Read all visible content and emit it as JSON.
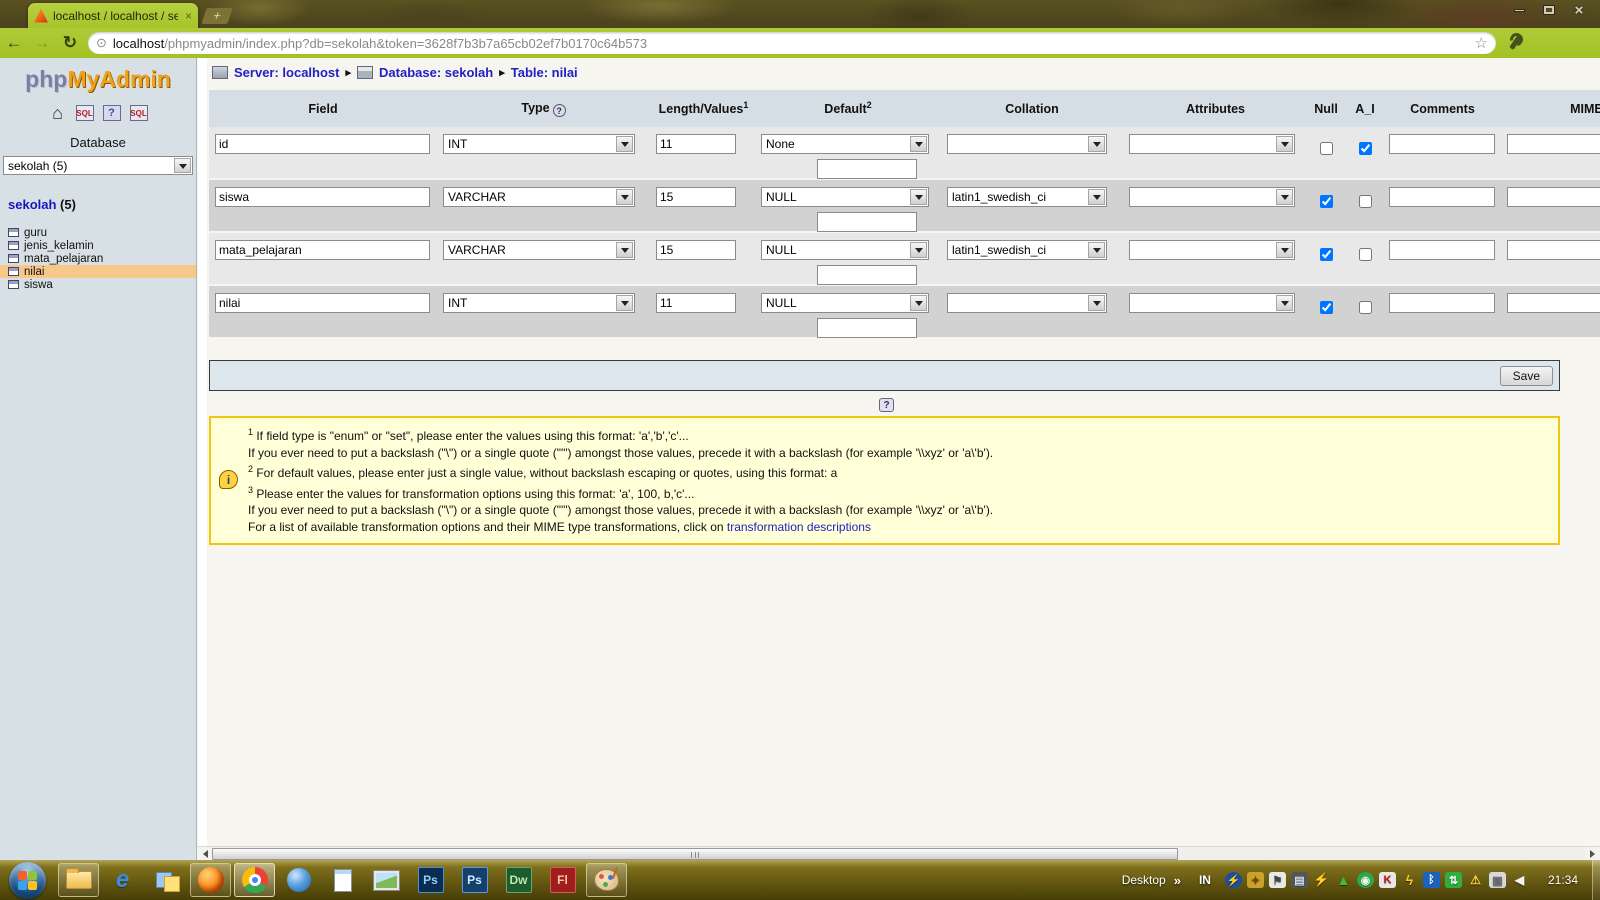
{
  "browser": {
    "tab_title": "localhost / localhost / sekol",
    "url_host": "localhost",
    "url_path": "/phpmyadmin/index.php?db=sekolah&token=3628f7b3b7a65cb02ef7b0170c64b573"
  },
  "icons": {
    "back_arrow": "←",
    "forward_arrow": "→",
    "reload": "↻",
    "globe": "⊙",
    "star": "☆",
    "tab_close": "×",
    "window_close": "×",
    "new_tab": "+",
    "breadcrumb_sep": "▸",
    "help": "?",
    "home": "⌂",
    "sql_label": "SQL",
    "info": "i"
  },
  "sidebar": {
    "logo_php": "php",
    "logo_myadmin": "MyAdmin",
    "database_label": "Database",
    "database_selected": "sekolah (5)",
    "db_name": "sekolah",
    "db_count": " (5)",
    "tables": [
      {
        "name": "guru"
      },
      {
        "name": "jenis_kelamin"
      },
      {
        "name": "mata_pelajaran"
      },
      {
        "name": "nilai"
      },
      {
        "name": "siswa"
      }
    ]
  },
  "breadcrumb": {
    "server": "Server: localhost",
    "database": "Database: sekolah",
    "table": "Table: nilai"
  },
  "structure": {
    "headers": {
      "field": "Field",
      "type": "Type",
      "length": "Length/Values",
      "length_sup": "1",
      "default": "Default",
      "default_sup": "2",
      "collation": "Collation",
      "attributes": "Attributes",
      "null": "Null",
      "ai": "A_I",
      "comments": "Comments",
      "mime": "MIME type"
    },
    "rows": [
      {
        "field": "id",
        "type": "INT",
        "length": "11",
        "default": "None",
        "collation": "",
        "attributes": "",
        "null": false,
        "ai": true,
        "comments": ""
      },
      {
        "field": "siswa",
        "type": "VARCHAR",
        "length": "15",
        "default": "NULL",
        "collation": "latin1_swedish_ci",
        "attributes": "",
        "null": true,
        "ai": false,
        "comments": ""
      },
      {
        "field": "mata_pelajaran",
        "type": "VARCHAR",
        "length": "15",
        "default": "NULL",
        "collation": "latin1_swedish_ci",
        "attributes": "",
        "null": true,
        "ai": false,
        "comments": ""
      },
      {
        "field": "nilai",
        "type": "INT",
        "length": "11",
        "default": "NULL",
        "collation": "",
        "attributes": "",
        "null": true,
        "ai": false,
        "comments": ""
      }
    ],
    "save_label": "Save"
  },
  "footnotes": {
    "sup1": "1",
    "line1": " If field type is \"enum\" or \"set\", please enter the values using this format: 'a','b','c'...",
    "line2": "If you ever need to put a backslash (\"\\\") or a single quote (\"'\") amongst those values, precede it with a backslash (for example '\\\\xyz' or 'a\\'b').",
    "sup2": "2",
    "line3": " For default values, please enter just a single value, without backslash escaping or quotes, using this format: a",
    "sup3": "3",
    "line4": " Please enter the values for transformation options using this format: 'a', 100, b,'c'...",
    "line5": "If you ever need to put a backslash (\"\\\") or a single quote (\"'\") amongst those values, precede it with a backslash (for example '\\\\xyz' or 'a\\'b').",
    "line6": "For a list of available transformation options and their MIME type transformations, click on ",
    "link": "transformation descriptions"
  },
  "taskbar": {
    "desktop_label": "Desktop",
    "overflow_chevron": "»",
    "language": "IN",
    "clock": "21:34",
    "ie_label": "e",
    "ps1_label": "Ps",
    "ps2_label": "Ps",
    "dw_label": "Dw",
    "fl_label": "Fl",
    "tray": [
      {
        "name": "amd-gaming-icon",
        "glyph": "⚡"
      },
      {
        "name": "tuneup-icon",
        "glyph": "✦"
      },
      {
        "name": "action-center-flag-icon",
        "glyph": "⚑"
      },
      {
        "name": "display-settings-icon",
        "glyph": "▤"
      },
      {
        "name": "messenger-bolt-icon",
        "glyph": "⚡"
      },
      {
        "name": "nvidia-icon",
        "glyph": "▲"
      },
      {
        "name": "idm-icon",
        "glyph": "◉"
      },
      {
        "name": "kaspersky-icon",
        "glyph": "K"
      },
      {
        "name": "boost-icon",
        "glyph": "ϟ"
      },
      {
        "name": "bluetooth-icon",
        "glyph": "ᛒ"
      },
      {
        "name": "network-transfer-icon",
        "glyph": "⇅"
      },
      {
        "name": "network-warning-icon",
        "glyph": "⚠"
      },
      {
        "name": "clipboard-icon",
        "glyph": "▣"
      },
      {
        "name": "volume-icon",
        "glyph": "◀"
      }
    ]
  },
  "colors": {
    "chrome_green": "#a6c42a",
    "sidebar_bg": "#d7e1e5",
    "header_bg": "#d5dee5",
    "row_odd": "#e8e8e8",
    "row_even": "#d2d2d2",
    "highlight_orange": "#f8c78a",
    "note_bg": "#ffffd8",
    "note_border": "#efc70c",
    "link_blue": "#2121c4"
  }
}
